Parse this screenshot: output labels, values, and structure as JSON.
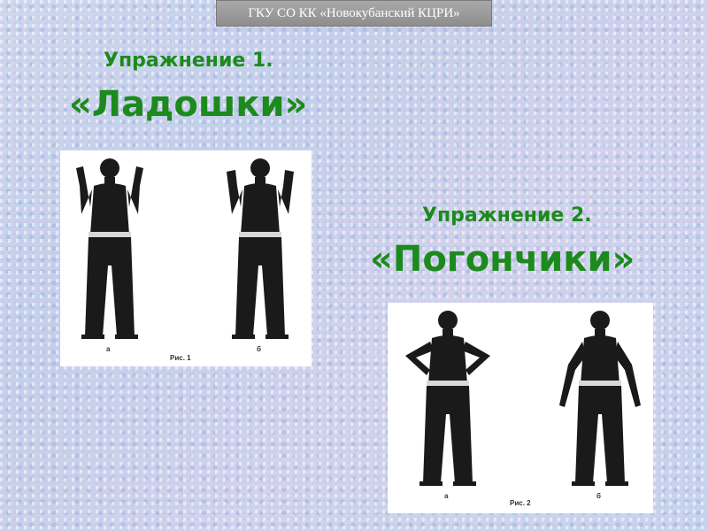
{
  "header": {
    "text": "ГКУ СО КК «Новокубанский КЦРИ»"
  },
  "exercise1": {
    "number_label": "Упражнение 1.",
    "name": "«Ладошки»",
    "figure": {
      "caption": "Рис. 1",
      "label_a": "а",
      "label_b": "б"
    }
  },
  "exercise2": {
    "number_label": "Упражнение 2.",
    "name": "«Погончики»",
    "figure": {
      "caption": "Рис. 2",
      "label_a": "а",
      "label_b": "б"
    }
  },
  "colors": {
    "title_green": "#1c8a1c",
    "header_gray": "#9a9a9a"
  }
}
